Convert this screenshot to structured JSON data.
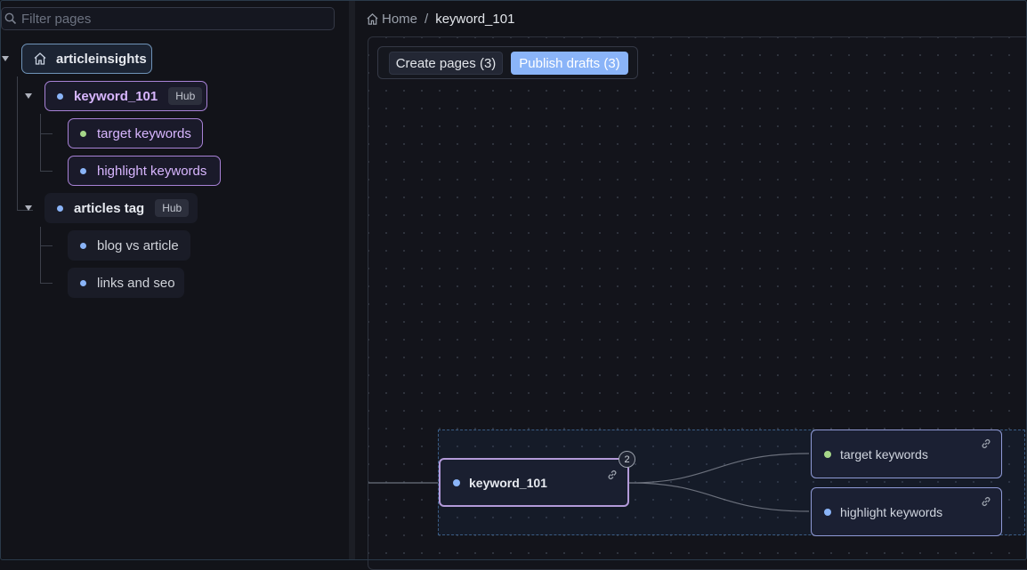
{
  "sidebar": {
    "filter_placeholder": "Filter pages",
    "tree": {
      "root": {
        "label": "articleinsights",
        "icon": "home-icon"
      },
      "hub1": {
        "label": "keyword_101",
        "badge": "Hub",
        "dot_color": "#8ab4f8",
        "children": [
          {
            "label": "target keywords",
            "dot_color": "#a6d689"
          },
          {
            "label": "highlight keywords",
            "dot_color": "#8ab4f8"
          }
        ]
      },
      "hub2": {
        "label": "articles tag",
        "badge": "Hub",
        "dot_color": "#8ab4f8",
        "children": [
          {
            "label": "blog vs article",
            "dot_color": "#8ab4f8"
          },
          {
            "label": "links and seo",
            "dot_color": "#8ab4f8"
          }
        ]
      }
    }
  },
  "breadcrumb": {
    "home": "Home",
    "separator": "/",
    "current": "keyword_101"
  },
  "toolbar": {
    "create_label": "Create pages (3)",
    "publish_label": "Publish drafts (3)",
    "accent": "#8ab4f8"
  },
  "canvas": {
    "main_node": {
      "label": "keyword_101",
      "count": "2",
      "dot_color": "#8ab4f8"
    },
    "children": [
      {
        "label": "target keywords",
        "dot_color": "#a6d689"
      },
      {
        "label": "highlight keywords",
        "dot_color": "#8ab4f8"
      }
    ]
  }
}
